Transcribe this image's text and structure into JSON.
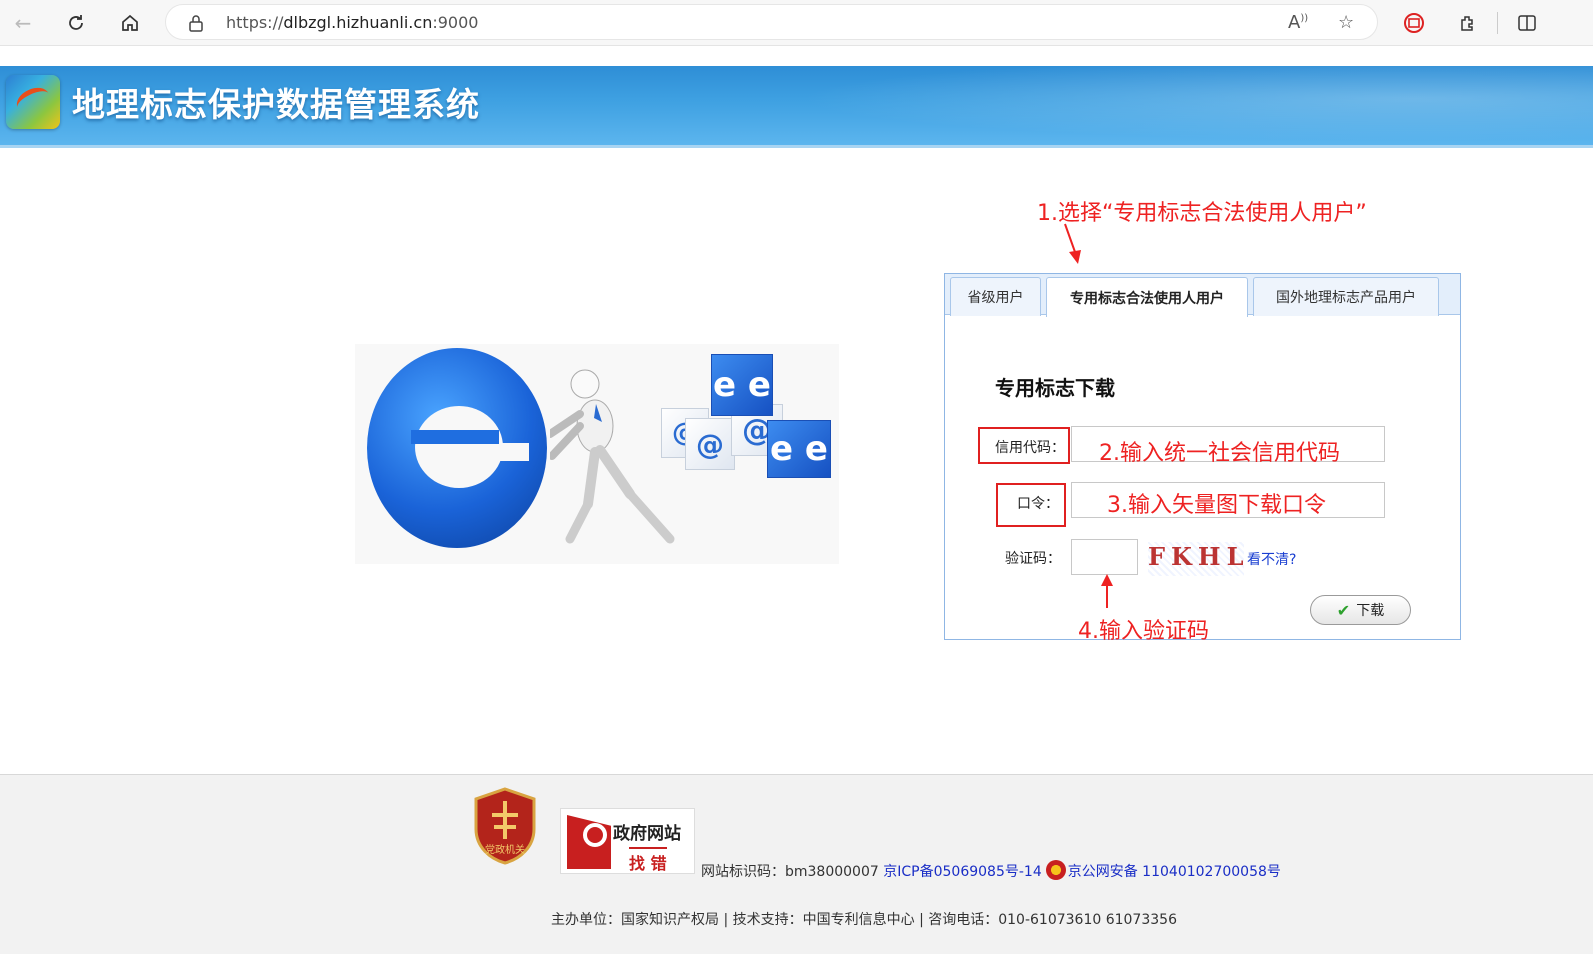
{
  "browser": {
    "url_prefix": "https://",
    "url_host": "dlbzgl.hizhuanli.cn",
    "url_port": ":9000",
    "icons": [
      "back-icon",
      "refresh-icon",
      "home-icon",
      "lock-icon",
      "read-aloud-icon",
      "favorite-icon",
      "extension-icon",
      "split-screen-icon"
    ]
  },
  "header": {
    "title": "地理标志保护数据管理系统"
  },
  "annotations": {
    "step1": "1.选择“专用标志合法使用人用户”",
    "step2": "2.输入统一社会信用代码",
    "step3": "3.输入矢量图下载口令",
    "step4": "4.输入验证码"
  },
  "login": {
    "tabs": [
      {
        "label": "省级用户",
        "active": false
      },
      {
        "label": "专用标志合法使用人用户",
        "active": true
      },
      {
        "label": "国外地理标志产品用户",
        "active": false
      }
    ],
    "form_title": "专用标志下载",
    "credit_code_label": "信用代码：",
    "password_label": "口令：",
    "captcha_label": "验证码：",
    "captcha_text": "FKHL",
    "captcha_refresh": "看不清?",
    "download_label": "下载"
  },
  "footer": {
    "party_badge": "党政机关",
    "gov_badge_line1": "政府网站",
    "gov_badge_line2": "找 错",
    "site_id": "网站标识码：bm38000007",
    "icp": "京ICP备05069085号-14",
    "police": "京公网安备 11040102700058号",
    "info": "主办单位：国家知识产权局 | 技术支持：中国专利信息中心 | 咨询电话：010-61073610 61073356"
  },
  "colors": {
    "header_blue": "#3fa1e2",
    "annotation_red": "#ee2222",
    "link_blue": "#1a2ec6"
  }
}
